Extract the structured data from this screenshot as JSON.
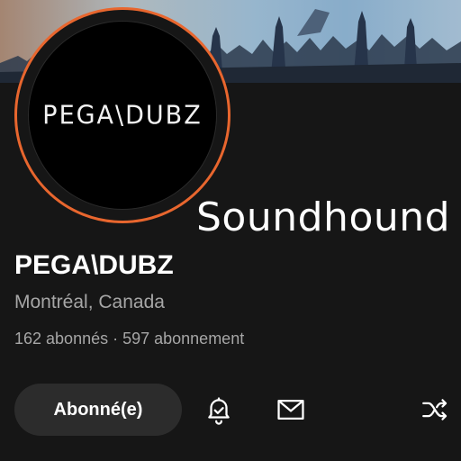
{
  "banner": {
    "image": "concert-crowd-banner"
  },
  "avatar": {
    "logo_text": "PEGA\\DUBZ",
    "ring_color": "#e8662e"
  },
  "watermark": {
    "text": "Soundhound"
  },
  "profile": {
    "name": "PEGA\\DUBZ",
    "location": "Montréal, Canada",
    "stats": "162 abonnés · 597 abonnement"
  },
  "actions": {
    "follow_label": "Abonné(e)",
    "icons": [
      "bell-icon",
      "mail-icon",
      "shuffle-icon"
    ]
  },
  "colors": {
    "background": "#161616",
    "button": "#2c2c2c",
    "secondary_text": "#a6a6a6"
  }
}
